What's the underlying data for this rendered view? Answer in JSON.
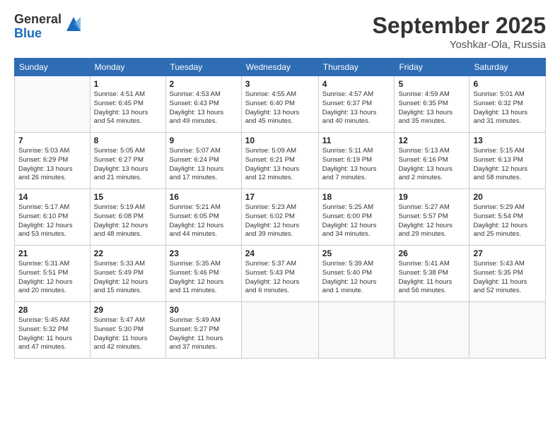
{
  "header": {
    "logo_general": "General",
    "logo_blue": "Blue",
    "month_title": "September 2025",
    "subtitle": "Yoshkar-Ola, Russia"
  },
  "weekdays": [
    "Sunday",
    "Monday",
    "Tuesday",
    "Wednesday",
    "Thursday",
    "Friday",
    "Saturday"
  ],
  "weeks": [
    [
      {
        "date": "",
        "info": ""
      },
      {
        "date": "1",
        "info": "Sunrise: 4:51 AM\nSunset: 6:45 PM\nDaylight: 13 hours\nand 54 minutes."
      },
      {
        "date": "2",
        "info": "Sunrise: 4:53 AM\nSunset: 6:43 PM\nDaylight: 13 hours\nand 49 minutes."
      },
      {
        "date": "3",
        "info": "Sunrise: 4:55 AM\nSunset: 6:40 PM\nDaylight: 13 hours\nand 45 minutes."
      },
      {
        "date": "4",
        "info": "Sunrise: 4:57 AM\nSunset: 6:37 PM\nDaylight: 13 hours\nand 40 minutes."
      },
      {
        "date": "5",
        "info": "Sunrise: 4:59 AM\nSunset: 6:35 PM\nDaylight: 13 hours\nand 35 minutes."
      },
      {
        "date": "6",
        "info": "Sunrise: 5:01 AM\nSunset: 6:32 PM\nDaylight: 13 hours\nand 31 minutes."
      }
    ],
    [
      {
        "date": "7",
        "info": "Sunrise: 5:03 AM\nSunset: 6:29 PM\nDaylight: 13 hours\nand 26 minutes."
      },
      {
        "date": "8",
        "info": "Sunrise: 5:05 AM\nSunset: 6:27 PM\nDaylight: 13 hours\nand 21 minutes."
      },
      {
        "date": "9",
        "info": "Sunrise: 5:07 AM\nSunset: 6:24 PM\nDaylight: 13 hours\nand 17 minutes."
      },
      {
        "date": "10",
        "info": "Sunrise: 5:09 AM\nSunset: 6:21 PM\nDaylight: 13 hours\nand 12 minutes."
      },
      {
        "date": "11",
        "info": "Sunrise: 5:11 AM\nSunset: 6:19 PM\nDaylight: 13 hours\nand 7 minutes."
      },
      {
        "date": "12",
        "info": "Sunrise: 5:13 AM\nSunset: 6:16 PM\nDaylight: 13 hours\nand 2 minutes."
      },
      {
        "date": "13",
        "info": "Sunrise: 5:15 AM\nSunset: 6:13 PM\nDaylight: 12 hours\nand 58 minutes."
      }
    ],
    [
      {
        "date": "14",
        "info": "Sunrise: 5:17 AM\nSunset: 6:10 PM\nDaylight: 12 hours\nand 53 minutes."
      },
      {
        "date": "15",
        "info": "Sunrise: 5:19 AM\nSunset: 6:08 PM\nDaylight: 12 hours\nand 48 minutes."
      },
      {
        "date": "16",
        "info": "Sunrise: 5:21 AM\nSunset: 6:05 PM\nDaylight: 12 hours\nand 44 minutes."
      },
      {
        "date": "17",
        "info": "Sunrise: 5:23 AM\nSunset: 6:02 PM\nDaylight: 12 hours\nand 39 minutes."
      },
      {
        "date": "18",
        "info": "Sunrise: 5:25 AM\nSunset: 6:00 PM\nDaylight: 12 hours\nand 34 minutes."
      },
      {
        "date": "19",
        "info": "Sunrise: 5:27 AM\nSunset: 5:57 PM\nDaylight: 12 hours\nand 29 minutes."
      },
      {
        "date": "20",
        "info": "Sunrise: 5:29 AM\nSunset: 5:54 PM\nDaylight: 12 hours\nand 25 minutes."
      }
    ],
    [
      {
        "date": "21",
        "info": "Sunrise: 5:31 AM\nSunset: 5:51 PM\nDaylight: 12 hours\nand 20 minutes."
      },
      {
        "date": "22",
        "info": "Sunrise: 5:33 AM\nSunset: 5:49 PM\nDaylight: 12 hours\nand 15 minutes."
      },
      {
        "date": "23",
        "info": "Sunrise: 5:35 AM\nSunset: 5:46 PM\nDaylight: 12 hours\nand 11 minutes."
      },
      {
        "date": "24",
        "info": "Sunrise: 5:37 AM\nSunset: 5:43 PM\nDaylight: 12 hours\nand 6 minutes."
      },
      {
        "date": "25",
        "info": "Sunrise: 5:39 AM\nSunset: 5:40 PM\nDaylight: 12 hours\nand 1 minute."
      },
      {
        "date": "26",
        "info": "Sunrise: 5:41 AM\nSunset: 5:38 PM\nDaylight: 11 hours\nand 56 minutes."
      },
      {
        "date": "27",
        "info": "Sunrise: 5:43 AM\nSunset: 5:35 PM\nDaylight: 11 hours\nand 52 minutes."
      }
    ],
    [
      {
        "date": "28",
        "info": "Sunrise: 5:45 AM\nSunset: 5:32 PM\nDaylight: 11 hours\nand 47 minutes."
      },
      {
        "date": "29",
        "info": "Sunrise: 5:47 AM\nSunset: 5:30 PM\nDaylight: 11 hours\nand 42 minutes."
      },
      {
        "date": "30",
        "info": "Sunrise: 5:49 AM\nSunset: 5:27 PM\nDaylight: 11 hours\nand 37 minutes."
      },
      {
        "date": "",
        "info": ""
      },
      {
        "date": "",
        "info": ""
      },
      {
        "date": "",
        "info": ""
      },
      {
        "date": "",
        "info": ""
      }
    ]
  ]
}
